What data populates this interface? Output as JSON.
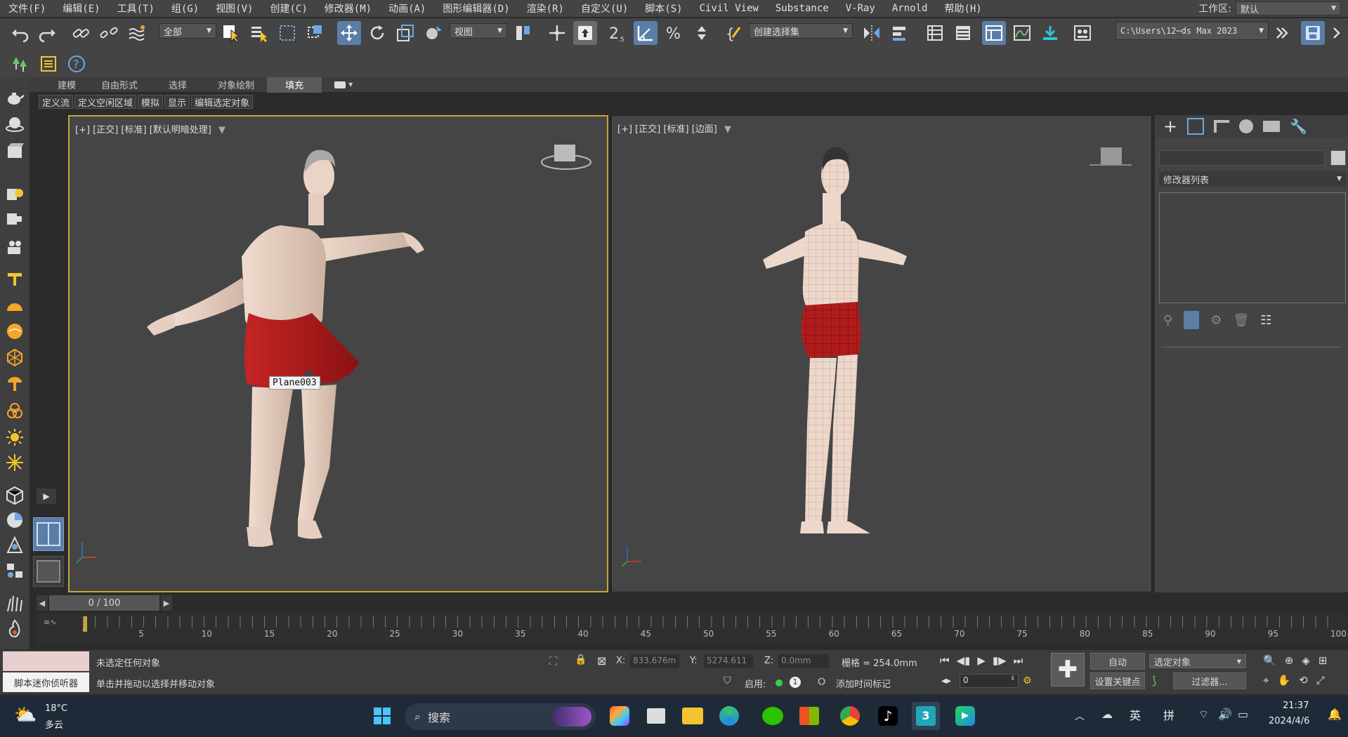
{
  "menu": [
    "文件(F)",
    "编辑(E)",
    "工具(T)",
    "组(G)",
    "视图(V)",
    "创建(C)",
    "修改器(M)",
    "动画(A)",
    "图形编辑器(D)",
    "渲染(R)",
    "自定义(U)",
    "脚本(S)",
    "Civil View",
    "Substance",
    "V-Ray",
    "Arnold",
    "帮助(H)"
  ],
  "workspace": {
    "label": "工作区:",
    "value": "默认"
  },
  "toolbar": {
    "filter_select": "全部",
    "coord_select": "视图",
    "num_25": "2.5",
    "selection_set": "创建选择集",
    "path": "C:\\Users\\12⋯ds Max 2023"
  },
  "ribbon": {
    "tabs": [
      "建模",
      "自由形式",
      "选择",
      "对象绘制",
      "填充"
    ],
    "active": "填充",
    "sub_tabs": [
      "定义流",
      "定义空闲区域",
      "模拟",
      "显示",
      "编辑选定对象"
    ]
  },
  "viewports": [
    {
      "label": "[+] [正交] [标准] [默认明暗处理]",
      "object_tag": "Plane003"
    },
    {
      "label": "[+] [正交] [标准] [边面]"
    }
  ],
  "command_panel": {
    "modifier_list": "修改器列表"
  },
  "timeline": {
    "frame": "0 / 100",
    "ticks": [
      "5",
      "10",
      "15",
      "20",
      "25",
      "30",
      "35",
      "40",
      "45",
      "50",
      "55",
      "60",
      "65",
      "70",
      "75",
      "80",
      "85",
      "90",
      "95",
      "100"
    ]
  },
  "status": {
    "script_listener": "脚本迷你侦听器",
    "line1": "未选定任何对象",
    "line2": "单击并拖动以选择并移动对象",
    "x_label": "X:",
    "x_value": "833.676m",
    "y_label": "Y:",
    "y_value": "5274.611",
    "z_label": "Z:",
    "z_value": "0.0mm",
    "grid": "栅格 = 254.0mm",
    "enable": "启用:",
    "add_time_tag": "添加时间标记",
    "auto": "自动",
    "set_key": "设置关键点",
    "selected": "选定对象",
    "filters": "过滤器...",
    "frame_field": "0"
  },
  "taskbar": {
    "weather_temp": "18°C",
    "weather_desc": "多云",
    "search": "搜索",
    "ime_en": "英",
    "ime_pin": "拼",
    "time": "21:37",
    "date": "2024/4/6"
  },
  "colors": {
    "accent": "#5b7ea8",
    "viewport_active": "#c8a43a",
    "skin": "#e8cfc0",
    "shorts": "#b01c1c"
  }
}
